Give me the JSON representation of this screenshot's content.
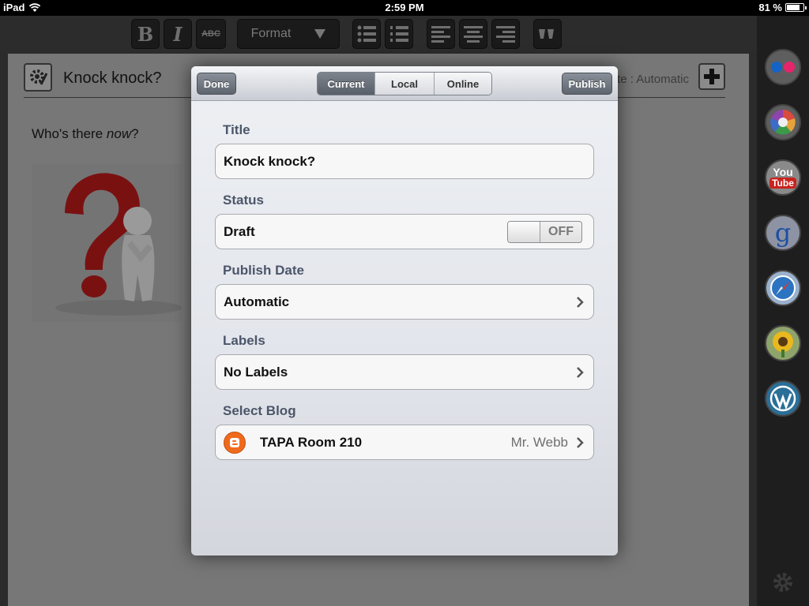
{
  "status_bar": {
    "carrier": "iPad",
    "time": "2:59 PM",
    "battery": "81 %",
    "battery_level": 0.81
  },
  "toolbar": {
    "bold_label": "B",
    "italic_label": "I",
    "strike_label": "ABC",
    "format_label": "Format"
  },
  "editor": {
    "title": "Knock knock?",
    "publish_date_hint": "te : Automatic",
    "body_prefix": "Who's there ",
    "body_emphasis": "now",
    "body_suffix": "?"
  },
  "popover": {
    "done_label": "Done",
    "publish_label": "Publish",
    "tabs": [
      {
        "label": "Current",
        "active": true
      },
      {
        "label": "Local",
        "active": false
      },
      {
        "label": "Online",
        "active": false
      }
    ],
    "sections": {
      "title": {
        "label": "Title",
        "value": "Knock knock?"
      },
      "status": {
        "label": "Status",
        "value": "Draft",
        "toggle": "OFF"
      },
      "publish_date": {
        "label": "Publish Date",
        "value": "Automatic"
      },
      "labels": {
        "label": "Labels",
        "value": "No Labels"
      },
      "blog": {
        "label": "Select Blog",
        "name": "TAPA Room 210",
        "author": "Mr. Webb"
      }
    }
  },
  "sidebar": {
    "icons": [
      "flickr-icon",
      "picasa-icon",
      "youtube-icon",
      "google-icon",
      "safari-icon",
      "sunflower-icon",
      "wordpress-icon"
    ],
    "youtube_top": "You",
    "youtube_bottom": "Tube",
    "google_letter": "g"
  },
  "colors": {
    "blogger_orange": "#f06a1d",
    "section_label": "#4c566a",
    "active_segment": "#6a717b"
  }
}
